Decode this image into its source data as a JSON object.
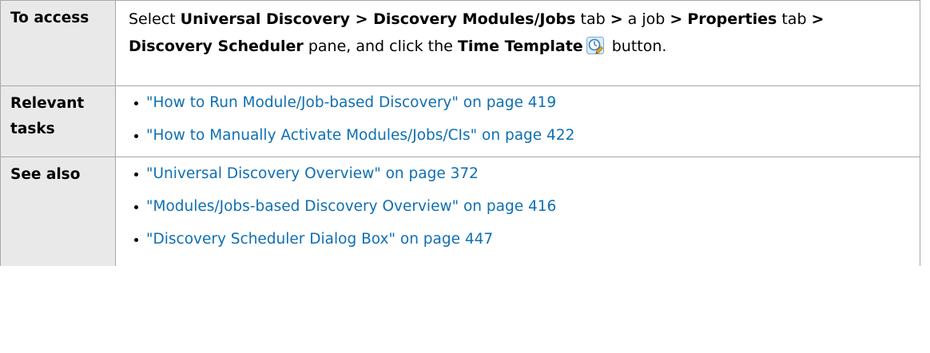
{
  "access": {
    "label": "To access",
    "parts": [
      "Select ",
      "Universal Discovery",
      " > ",
      "Discovery Modules/Jobs",
      " tab ",
      ">",
      " a job ",
      ">",
      " ",
      "Properties",
      " tab ",
      ">",
      " ",
      "Discovery Scheduler",
      " pane, and click the ",
      "Time Template",
      " button."
    ],
    "icon": "time-template-icon"
  },
  "relevant_tasks": {
    "label": "Relevant tasks",
    "items": [
      "\"How to Run Module/Job-based Discovery\" on page 419",
      "\"How to Manually Activate Modules/Jobs/CIs\" on page 422"
    ]
  },
  "see_also": {
    "label": "See also",
    "items": [
      "\"Universal Discovery Overview\" on page 372",
      "\"Modules/Jobs-based Discovery Overview\" on page 416",
      "\"Discovery Scheduler Dialog Box\" on page 447"
    ]
  },
  "colors": {
    "link": "#0f6fb3",
    "label_bg": "#e9e9e9",
    "border": "#a8a8a8"
  }
}
